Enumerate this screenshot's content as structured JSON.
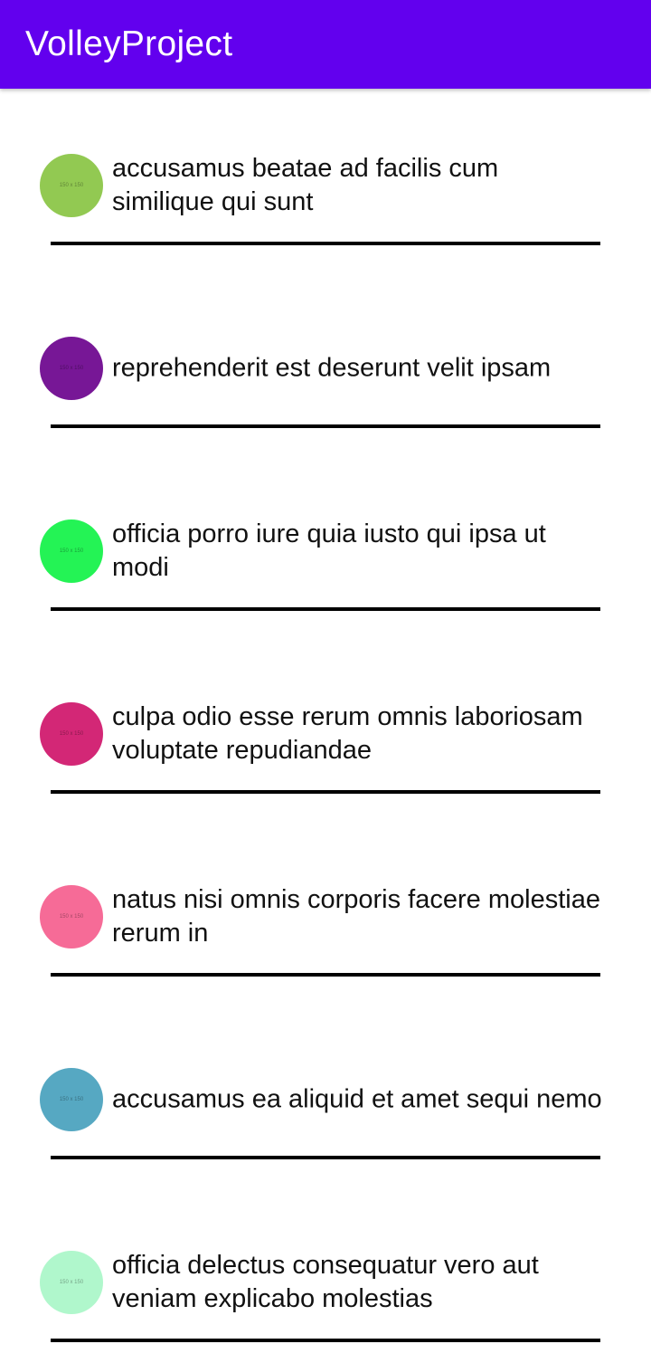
{
  "appbar": {
    "title": "VolleyProject",
    "color": "#6200ee"
  },
  "items": [
    {
      "title": "accusamus beatae ad facilis cum similique qui sunt",
      "thumb_color": "#92c952",
      "thumb_label": "150 x 150"
    },
    {
      "title": "reprehenderit est deserunt velit ipsam",
      "thumb_color": "#771796",
      "thumb_label": "150 x 150"
    },
    {
      "title": "officia porro iure quia iusto qui ipsa ut modi",
      "thumb_color": "#24f355",
      "thumb_label": "150 x 150"
    },
    {
      "title": "culpa odio esse rerum omnis laboriosam voluptate repudiandae",
      "thumb_color": "#d32776",
      "thumb_label": "150 x 150"
    },
    {
      "title": "natus nisi omnis corporis facere molestiae rerum in",
      "thumb_color": "#f66b97",
      "thumb_label": "150 x 150"
    },
    {
      "title": "accusamus ea aliquid et amet sequi nemo",
      "thumb_color": "#56a8c2",
      "thumb_label": "150 x 150"
    },
    {
      "title": "officia delectus consequatur vero aut veniam explicabo molestias",
      "thumb_color": "#b0f7cc",
      "thumb_label": "150 x 150"
    }
  ]
}
